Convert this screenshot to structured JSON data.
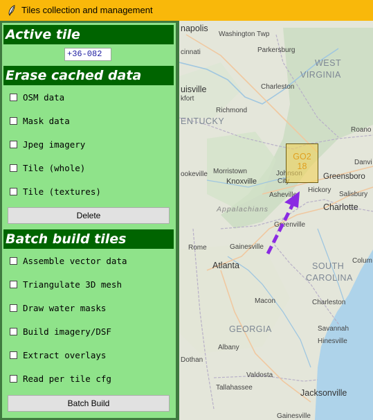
{
  "window": {
    "title": "Tiles collection and management",
    "icon": "feather-icon"
  },
  "active_tile": {
    "header": "Active tile",
    "value": "+36-082"
  },
  "erase": {
    "header": "Erase cached data",
    "options": [
      {
        "label": "OSM data",
        "checked": false
      },
      {
        "label": "Mask data",
        "checked": false
      },
      {
        "label": "Jpeg imagery",
        "checked": false
      },
      {
        "label": "Tile (whole)",
        "checked": false
      },
      {
        "label": "Tile (textures)",
        "checked": false
      }
    ],
    "button_label": "Delete"
  },
  "batch": {
    "header": "Batch build tiles",
    "options": [
      {
        "label": "Assemble vector data",
        "checked": false
      },
      {
        "label": "Triangulate 3D mesh",
        "checked": false
      },
      {
        "label": "Draw water masks",
        "checked": false
      },
      {
        "label": "Build imagery/DSF",
        "checked": false
      },
      {
        "label": "Extract overlays",
        "checked": false
      },
      {
        "label": "Read per tile cfg",
        "checked": false
      }
    ],
    "button_label": "Batch Build"
  },
  "map": {
    "tile_marker": {
      "line1": "GO2",
      "line2": "18"
    },
    "colors": {
      "marker_fill": "#f2d25a",
      "marker_border": "#a8861a",
      "arrow": "#8a2be2"
    },
    "labels": {
      "napolis": "napolis",
      "washington_twp": "Washington Twp",
      "parkersburg": "Parkersburg",
      "cinnati": "cinnati",
      "west": "WEST",
      "virginia": "VIRGINIA",
      "charleston_wv": "Charleston",
      "uisville": "uisville",
      "kfort": "kfort",
      "richmond": "Richmond",
      "entucky": "ENTUCKY",
      "roanoke": "Roano",
      "johnson": "Johnson",
      "city": "City",
      "greensboro": "Greensboro",
      "danville": "Danvi",
      "morristown": "Morristown",
      "knoxville": "Knoxville",
      "ookeville": "ookeville",
      "asheville": "Asheville",
      "hickory": "Hickory",
      "salisbury": "Salisbury",
      "charlotte": "Charlotte",
      "appalachians": "Appalachians",
      "greenville": "Greenville",
      "gainesville": "Gainesville",
      "rome": "Rome",
      "atlanta": "Atlanta",
      "south": "SOUTH",
      "carolina": "CAROLINA",
      "columbia": "Colum",
      "macon": "Macon",
      "charleston_sc": "Charleston",
      "georgia": "GEORGIA",
      "savannah": "Savannah",
      "hinesville": "Hinesville",
      "albany": "Albany",
      "dothan": "Dothan",
      "valdosta": "Valdosta",
      "tallahassee": "Tallahassee",
      "jacksonville": "Jacksonville",
      "gainesville_fl": "Gainesville"
    }
  }
}
